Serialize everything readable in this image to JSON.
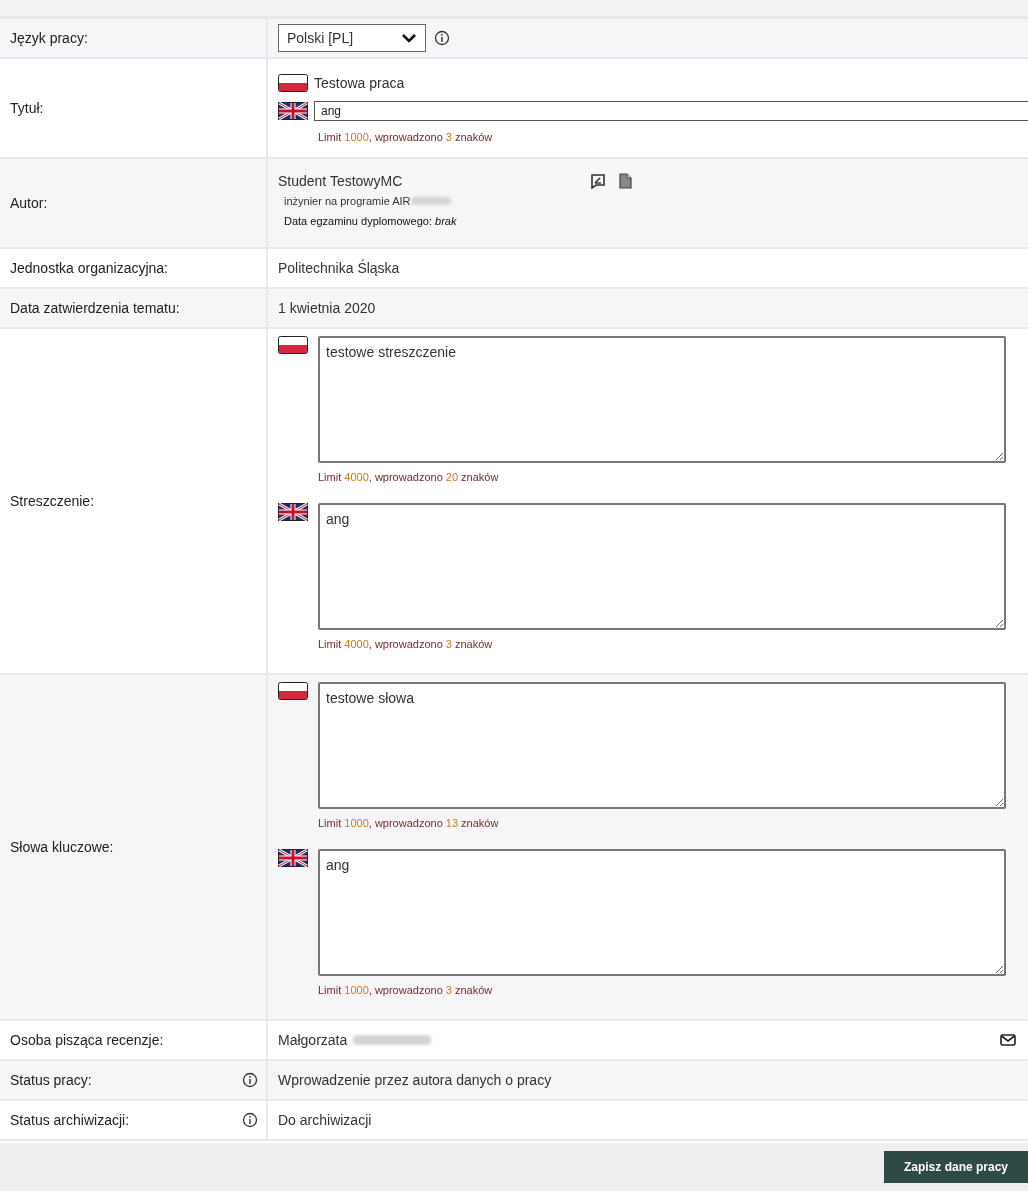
{
  "rows": [
    {
      "kind": "select",
      "label": "Język pracy:",
      "value": "Polski [PL]",
      "info": true
    },
    {
      "kind": "title",
      "label": "Tytuł:",
      "text_pl": "Testowa praca",
      "value_en": "ang",
      "counter": {
        "before": "Limit",
        "limit": "1000",
        "middle": ", wprowadzono",
        "count": "3",
        "after": "znaków"
      }
    },
    {
      "kind": "author",
      "label": "Autor:",
      "name": "Student TestowyMC",
      "degree": "inżynier na programie AIR",
      "exam_label": "Data egzaminu dyplomowego:",
      "exam_value": "brak"
    },
    {
      "kind": "text",
      "label": "Jednostka organizacyjna:",
      "value": "Politechnika Śląska"
    },
    {
      "kind": "text",
      "label": "Data zatwierdzenia tematu:",
      "value": "1 kwietnia 2020"
    },
    {
      "kind": "areas",
      "label": "Streszczenie:",
      "areas": [
        {
          "value": "testowe streszczenie",
          "counter": {
            "before": "Limit",
            "limit": "4000",
            "middle": ", wprowadzono",
            "count": "20",
            "after": "znaków"
          }
        },
        {
          "value": "ang",
          "counter": {
            "before": "Limit",
            "limit": "4000",
            "middle": ", wprowadzono",
            "count": "3",
            "after": "znaków"
          }
        }
      ]
    },
    {
      "kind": "areas",
      "label": "Słowa kluczowe:",
      "areas": [
        {
          "value": "testowe słowa",
          "counter": {
            "before": "Limit",
            "limit": "1000",
            "middle": ", wprowadzono",
            "count": "13",
            "after": "znaków"
          }
        },
        {
          "value": "ang",
          "counter": {
            "before": "Limit",
            "limit": "1000",
            "middle": ", wprowadzono",
            "count": "3",
            "after": "znaków"
          }
        }
      ]
    },
    {
      "kind": "reviewer",
      "label": "Osoba pisząca recenzje:",
      "value": "Małgorzata"
    },
    {
      "kind": "text",
      "label": "Status pracy:",
      "value": "Wprowadzenie przez autora danych o pracy",
      "info": true
    },
    {
      "kind": "text",
      "label": "Status archiwizacji:",
      "value": "Do archiwizacji",
      "info": true
    }
  ],
  "save_button": "Zapisz dane pracy"
}
